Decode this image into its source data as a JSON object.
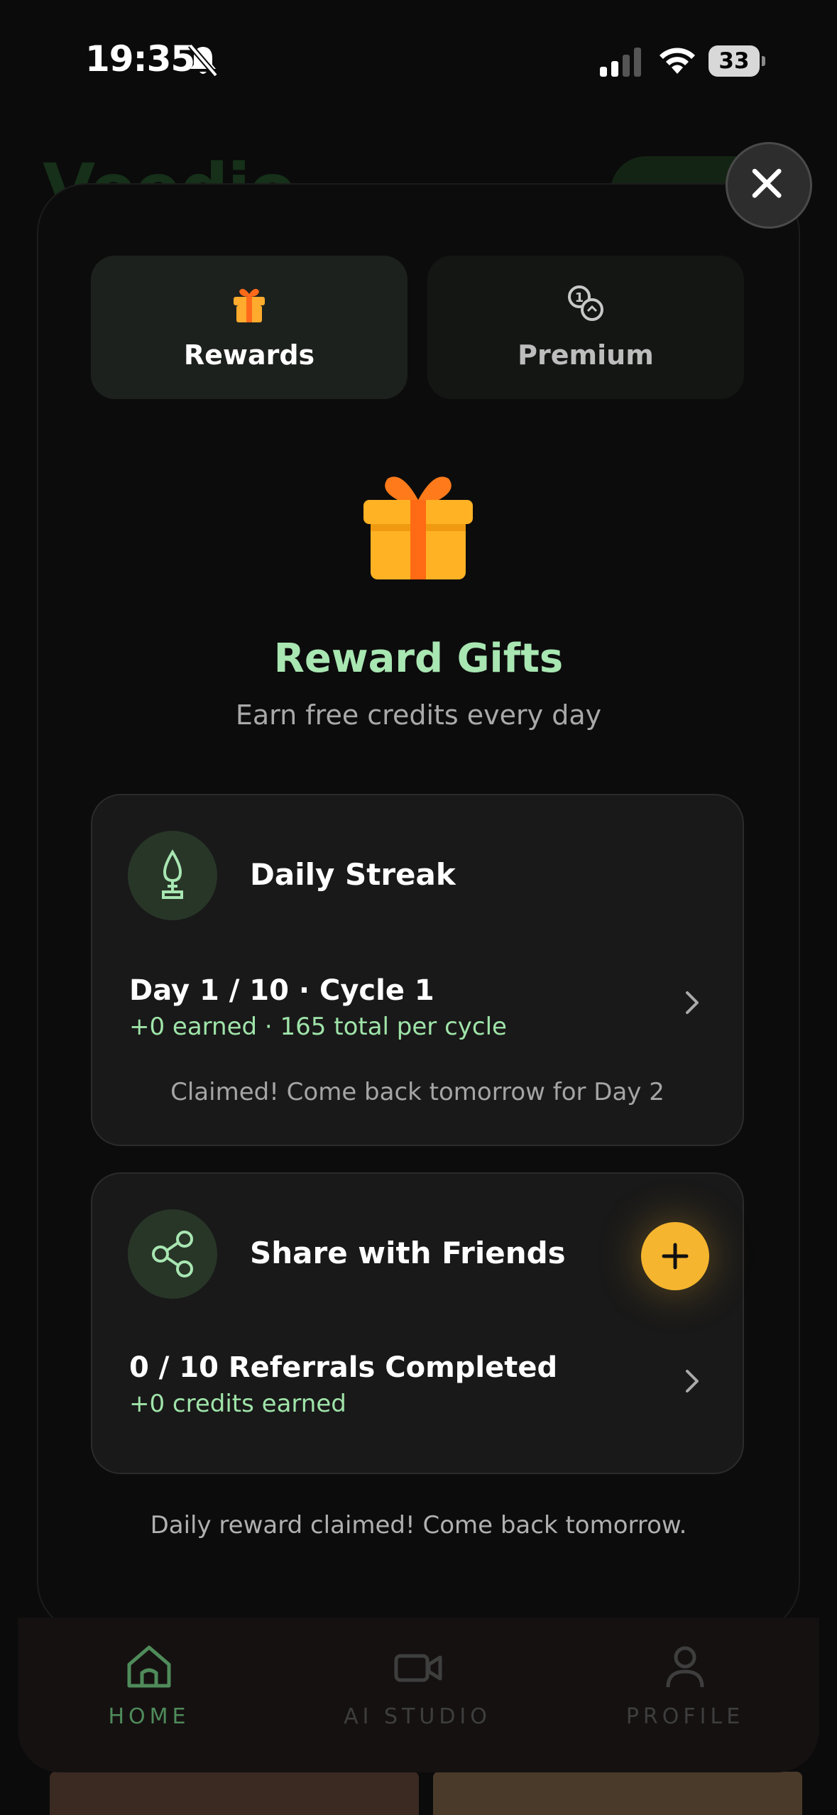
{
  "status_bar": {
    "time": "19:35",
    "battery": "33"
  },
  "background": {
    "logo": "Veedio"
  },
  "tabs": [
    {
      "label": "Rewards",
      "icon": "gift-icon",
      "active": true
    },
    {
      "label": "Premium",
      "icon": "coins-icon",
      "active": false
    }
  ],
  "hero": {
    "title": "Reward Gifts",
    "subtitle": "Earn free credits every day"
  },
  "daily_streak": {
    "title": "Daily Streak",
    "progress": "Day 1 / 10 · Cycle 1",
    "earned": "+0 earned · 165 total per cycle",
    "note": "Claimed! Come back tomorrow for Day 2"
  },
  "share": {
    "title": "Share with Friends",
    "progress": "0 / 10 Referrals Completed",
    "earned": "+0 credits earned"
  },
  "footer_note": "Daily reward claimed! Come back tomorrow.",
  "nav": [
    {
      "label": "HOME",
      "icon": "home-icon",
      "active": true
    },
    {
      "label": "AI STUDIO",
      "icon": "video-camera-icon",
      "active": false
    },
    {
      "label": "PROFILE",
      "icon": "person-icon",
      "active": false
    }
  ],
  "colors": {
    "accent_green": "#a8e6b2",
    "accent_yellow": "#f5b52f",
    "gift_orange": "#ff8c1a"
  }
}
